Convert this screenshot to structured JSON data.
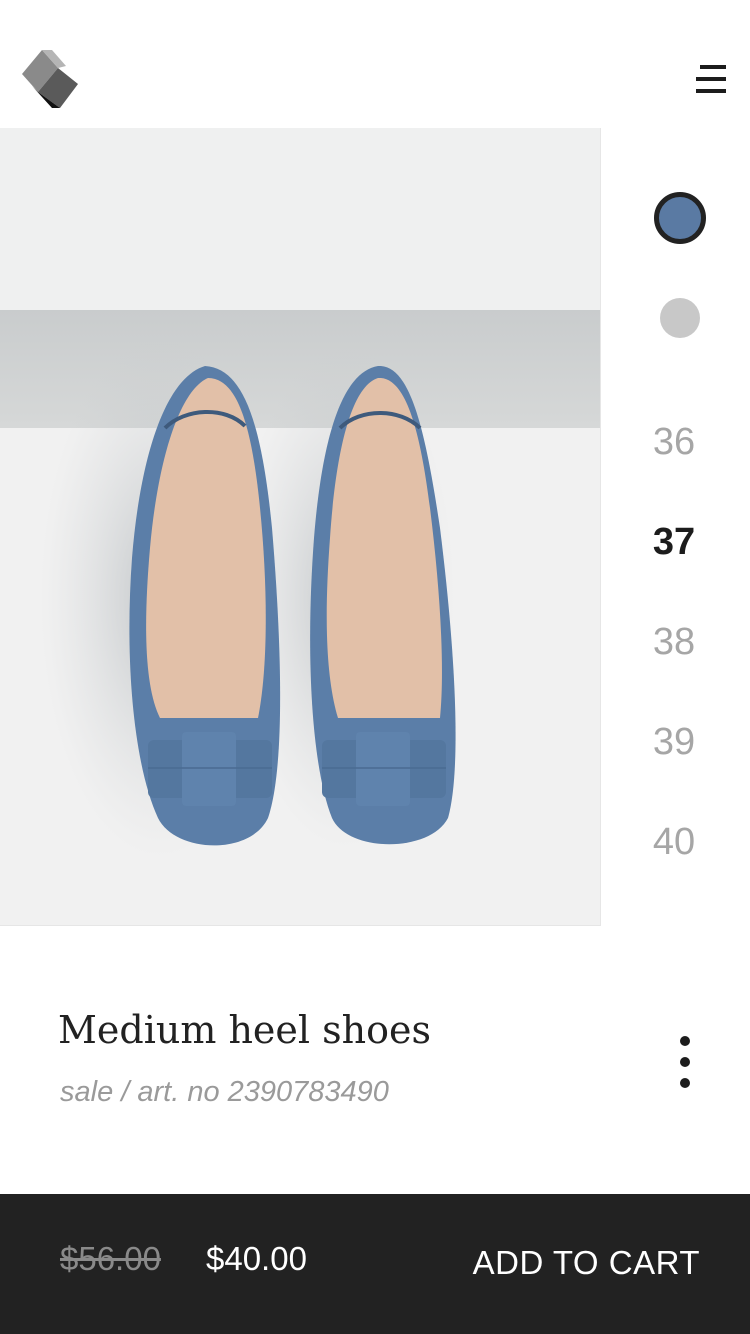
{
  "header": {
    "logo_icon": "cube-logo-icon",
    "menu_icon": "hamburger-menu-icon"
  },
  "product": {
    "title": "Medium heel shoes",
    "subtitle": "sale / art. no 2390783490",
    "image": "blue-suede-bow-flats-image",
    "more_icon": "vertical-dots-icon"
  },
  "colors": {
    "selected": "#5a7aa3",
    "unselected": "#c8c8c8"
  },
  "sizes": [
    {
      "label": "36",
      "active": false
    },
    {
      "label": "37",
      "active": true
    },
    {
      "label": "38",
      "active": false
    },
    {
      "label": "39",
      "active": false
    },
    {
      "label": "40",
      "active": false
    }
  ],
  "pricing": {
    "old_price": "$56.00",
    "new_price": "$40.00"
  },
  "cart": {
    "button_label": "ADD TO CART"
  }
}
